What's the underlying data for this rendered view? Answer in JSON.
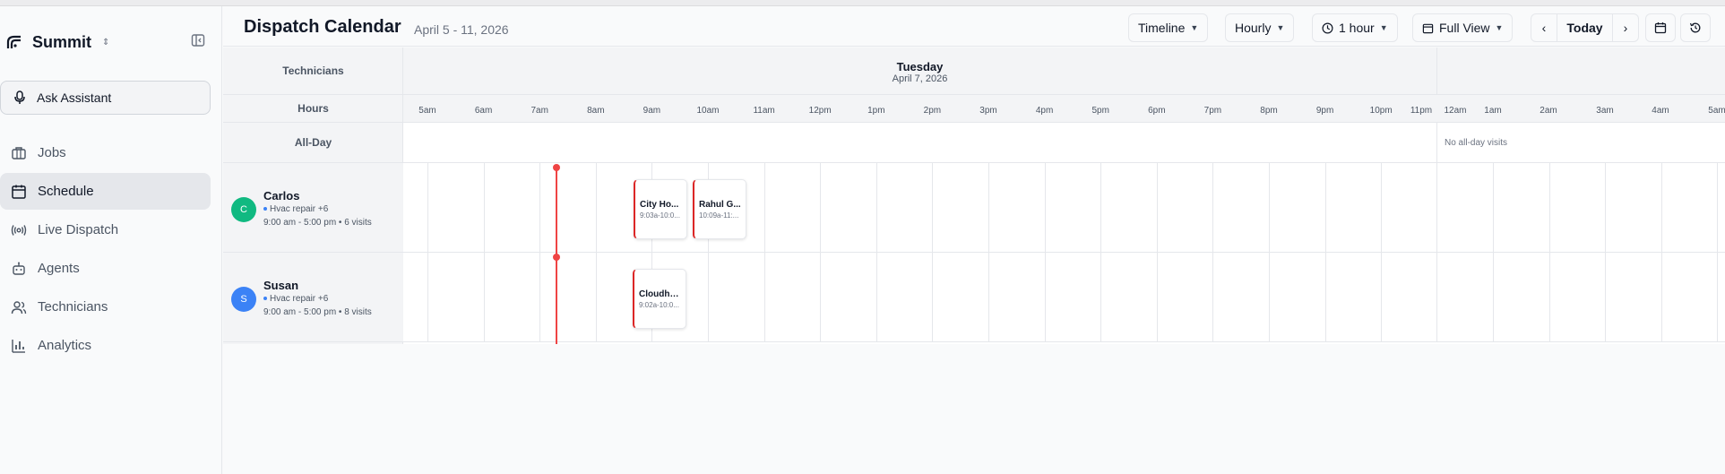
{
  "app": {
    "name": "Summit"
  },
  "sidebar": {
    "assistant_label": "Ask Assistant",
    "items": [
      {
        "label": "Jobs",
        "icon": "briefcase-icon",
        "active": false
      },
      {
        "label": "Schedule",
        "icon": "calendar-icon",
        "active": true
      },
      {
        "label": "Live Dispatch",
        "icon": "broadcast-icon",
        "active": false
      },
      {
        "label": "Agents",
        "icon": "robot-icon",
        "active": false
      },
      {
        "label": "Technicians",
        "icon": "users-icon",
        "active": false
      },
      {
        "label": "Analytics",
        "icon": "bar-chart-icon",
        "active": false
      }
    ]
  },
  "header": {
    "title": "Dispatch Calendar",
    "date_range": "April 5 - 11, 2026",
    "view_label": "Timeline",
    "scale_label": "Hourly",
    "interval_label": "1 hour",
    "fullview_label": "Full View",
    "today_label": "Today"
  },
  "calendar": {
    "technicians_label": "Technicians",
    "hours_label": "Hours",
    "allday_label": "All-Day",
    "day": {
      "name": "Tuesday",
      "date": "April 7, 2026"
    },
    "hours": [
      "5am",
      "6am",
      "7am",
      "8am",
      "9am",
      "10am",
      "11am",
      "12pm",
      "1pm",
      "2pm",
      "3pm",
      "4pm",
      "5pm",
      "6pm",
      "7pm",
      "8pm",
      "9pm",
      "10pm",
      "11pm"
    ],
    "next_day_hours": [
      "12am",
      "1am",
      "2am",
      "3am",
      "4am",
      "5am"
    ],
    "no_allday_text": "No all-day visits",
    "technicians": [
      {
        "name": "Carlos",
        "initial": "C",
        "color": "#10b981",
        "skills": "Hvac repair +6",
        "hours": "9:00 am - 5:00 pm • 6 visits",
        "visits": [
          {
            "title": "City Ho...",
            "time": "9:03a-10:0..."
          },
          {
            "title": "Rahul G...",
            "time": "10:09a-11:..."
          }
        ]
      },
      {
        "name": "Susan",
        "initial": "S",
        "color": "#3b82f6",
        "skills": "Hvac repair +6",
        "hours": "9:00 am - 5:00 pm • 8 visits",
        "visits": [
          {
            "title": "Cloudho...",
            "time": "9:02a-10:0..."
          }
        ]
      }
    ]
  },
  "colors": {
    "accent": "#ef4444",
    "visit_border": "#dc2626"
  }
}
